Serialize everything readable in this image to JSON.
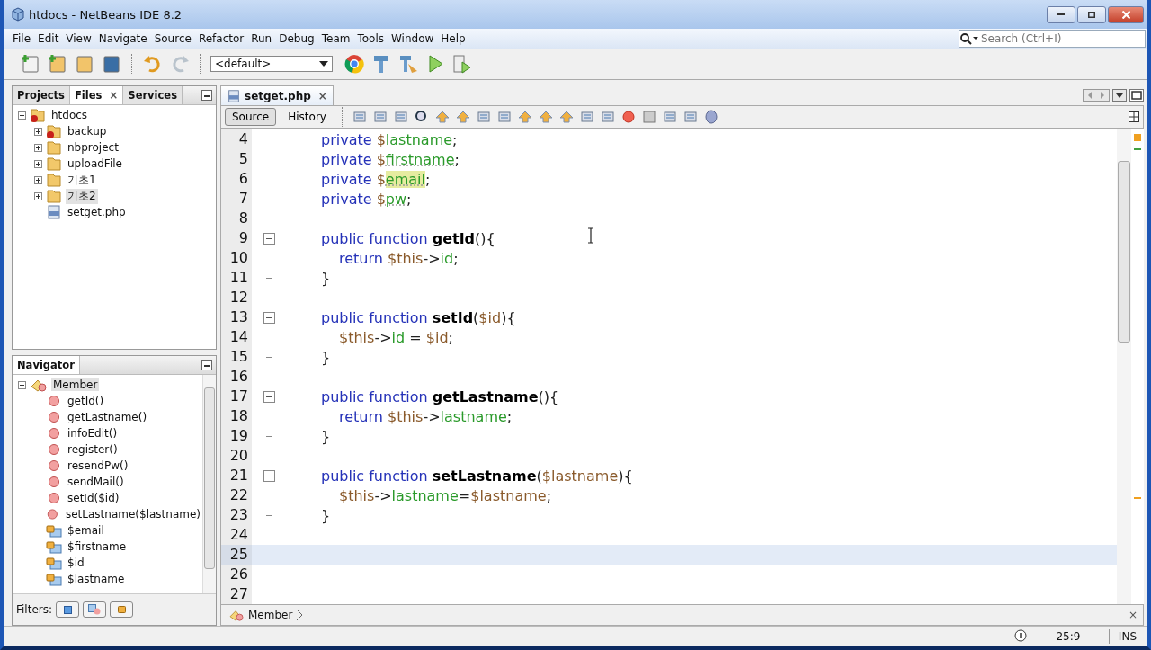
{
  "window": {
    "title": "htdocs - NetBeans IDE 8.2"
  },
  "menu": [
    "File",
    "Edit",
    "View",
    "Navigate",
    "Source",
    "Refactor",
    "Run",
    "Debug",
    "Team",
    "Tools",
    "Window",
    "Help"
  ],
  "search": {
    "placeholder": "Search (Ctrl+I)"
  },
  "config_dropdown": {
    "value": "<default>"
  },
  "side_tabs": [
    {
      "label": "Projects",
      "selected": false
    },
    {
      "label": "Files",
      "selected": true,
      "close_mark": "×"
    },
    {
      "label": "Services",
      "selected": false
    }
  ],
  "files_tree": {
    "label": "htdocs",
    "expanded": true,
    "selected": false,
    "error": true,
    "children": [
      {
        "label": "backup",
        "kind": "folder",
        "expanded": false,
        "selected": false,
        "error": true
      },
      {
        "label": "nbproject",
        "kind": "folder",
        "expanded": false,
        "selected": false,
        "error": false
      },
      {
        "label": "uploadFile",
        "kind": "folder",
        "expanded": false,
        "selected": false,
        "error": false
      },
      {
        "label": "기초1",
        "kind": "folder",
        "expanded": false,
        "selected": false,
        "error": false
      },
      {
        "label": "기초2",
        "kind": "folder",
        "expanded": false,
        "selected": true,
        "error": false
      },
      {
        "label": "setget.php",
        "kind": "file",
        "selected": false
      }
    ]
  },
  "navigator": {
    "title": "Navigator",
    "root": {
      "label": "Member",
      "selected": true,
      "children": [
        {
          "label": "getId()",
          "kind": "method"
        },
        {
          "label": "getLastname()",
          "kind": "method"
        },
        {
          "label": "infoEdit()",
          "kind": "method"
        },
        {
          "label": "register()",
          "kind": "method"
        },
        {
          "label": "resendPw()",
          "kind": "method"
        },
        {
          "label": "sendMail()",
          "kind": "method"
        },
        {
          "label": "setId($id)",
          "kind": "method"
        },
        {
          "label": "setLastname($lastname)",
          "kind": "method"
        },
        {
          "label": "$email",
          "kind": "field"
        },
        {
          "label": "$firstname",
          "kind": "field"
        },
        {
          "label": "$id",
          "kind": "field"
        },
        {
          "label": "$lastname",
          "kind": "field"
        }
      ]
    },
    "filters_label": "Filters:"
  },
  "editor_tab": {
    "label": "setget.php",
    "selected": true,
    "close_mark": "×"
  },
  "view_toggle": [
    {
      "label": "Source",
      "selected": true
    },
    {
      "label": "History",
      "selected": false
    }
  ],
  "code_lines": [
    {
      "number": "4",
      "current": false,
      "tokens": [
        {
          "t": "private ",
          "kind": "kw"
        },
        {
          "t": "$",
          "kind": "var"
        },
        {
          "t": "lastname",
          "kind": "field"
        },
        {
          "t": ";",
          "kind": "plain"
        }
      ]
    },
    {
      "number": "5",
      "current": false,
      "tokens": [
        {
          "t": "private ",
          "kind": "kw"
        },
        {
          "t": "$",
          "kind": "var"
        },
        {
          "t": "firstname",
          "kind": "field-warn"
        },
        {
          "t": ";",
          "kind": "plain"
        }
      ]
    },
    {
      "number": "6",
      "current": false,
      "tokens": [
        {
          "t": "private ",
          "kind": "kw"
        },
        {
          "t": "$",
          "kind": "var"
        },
        {
          "t": "email",
          "kind": "field-mark"
        },
        {
          "t": ";",
          "kind": "plain"
        }
      ]
    },
    {
      "number": "7",
      "current": false,
      "tokens": [
        {
          "t": "private ",
          "kind": "kw"
        },
        {
          "t": "$",
          "kind": "var"
        },
        {
          "t": "pw",
          "kind": "field-warn"
        },
        {
          "t": ";",
          "kind": "plain"
        }
      ]
    },
    {
      "number": "8",
      "current": false
    },
    {
      "number": "9",
      "current": false,
      "fold_start": true,
      "tokens": [
        {
          "t": "public function ",
          "kind": "kw"
        },
        {
          "t": "getId",
          "kind": "name"
        },
        {
          "t": "(){",
          "kind": "plain"
        }
      ],
      "children": [
        {
          "number": "10",
          "current": false,
          "tokens": [
            {
              "t": "return ",
              "kind": "kw"
            },
            {
              "t": "$this",
              "kind": "var"
            },
            {
              "t": "->",
              "kind": "plain"
            },
            {
              "t": "id",
              "kind": "field"
            },
            {
              "t": ";",
              "kind": "plain"
            }
          ]
        }
      ]
    },
    {
      "number": "11",
      "current": false,
      "fold_end": true,
      "tokens": [
        {
          "t": "}",
          "kind": "plain"
        }
      ]
    },
    {
      "number": "12",
      "current": false
    },
    {
      "number": "13",
      "current": false,
      "fold_start": true,
      "tokens": [
        {
          "t": "public function ",
          "kind": "kw"
        },
        {
          "t": "setId",
          "kind": "name"
        },
        {
          "t": "(",
          "kind": "plain"
        },
        {
          "t": "$id",
          "kind": "var"
        },
        {
          "t": "){",
          "kind": "plain"
        }
      ],
      "children": [
        {
          "number": "14",
          "current": false,
          "tokens": [
            {
              "t": "$this",
              "kind": "var"
            },
            {
              "t": "->",
              "kind": "plain"
            },
            {
              "t": "id",
              "kind": "field"
            },
            {
              "t": " = ",
              "kind": "plain"
            },
            {
              "t": "$id",
              "kind": "var"
            },
            {
              "t": ";",
              "kind": "plain"
            }
          ]
        }
      ]
    },
    {
      "number": "15",
      "current": false,
      "fold_end": true,
      "tokens": [
        {
          "t": "}",
          "kind": "plain"
        }
      ]
    },
    {
      "number": "16",
      "current": false
    },
    {
      "number": "17",
      "current": false,
      "fold_start": true,
      "tokens": [
        {
          "t": "public function ",
          "kind": "kw"
        },
        {
          "t": "getLastname",
          "kind": "name"
        },
        {
          "t": "(){",
          "kind": "plain"
        }
      ],
      "children": [
        {
          "number": "18",
          "current": false,
          "tokens": [
            {
              "t": "return ",
              "kind": "kw"
            },
            {
              "t": "$this",
              "kind": "var"
            },
            {
              "t": "->",
              "kind": "plain"
            },
            {
              "t": "lastname",
              "kind": "field"
            },
            {
              "t": ";",
              "kind": "plain"
            }
          ]
        }
      ]
    },
    {
      "number": "19",
      "current": false,
      "fold_end": true,
      "tokens": [
        {
          "t": "}",
          "kind": "plain"
        }
      ]
    },
    {
      "number": "20",
      "current": false
    },
    {
      "number": "21",
      "current": false,
      "fold_start": true,
      "tokens": [
        {
          "t": "public function ",
          "kind": "kw"
        },
        {
          "t": "setLastname",
          "kind": "name"
        },
        {
          "t": "(",
          "kind": "plain"
        },
        {
          "t": "$lastname",
          "kind": "var"
        },
        {
          "t": "){",
          "kind": "plain"
        }
      ],
      "children": [
        {
          "number": "22",
          "current": false,
          "tokens": [
            {
              "t": "$this",
              "kind": "var"
            },
            {
              "t": "->",
              "kind": "plain"
            },
            {
              "t": "lastname",
              "kind": "field"
            },
            {
              "t": "=",
              "kind": "plain"
            },
            {
              "t": "$lastname",
              "kind": "var"
            },
            {
              "t": ";",
              "kind": "plain"
            }
          ]
        }
      ]
    },
    {
      "number": "23",
      "current": false,
      "fold_end": true,
      "tokens": [
        {
          "t": "}",
          "kind": "plain"
        }
      ]
    },
    {
      "number": "24",
      "current": false
    },
    {
      "number": "25",
      "current": true
    },
    {
      "number": "26",
      "current": false
    },
    {
      "number": "27",
      "current": false
    }
  ],
  "breadcrumb": {
    "items": [
      "Member"
    ],
    "close_mark": "×"
  },
  "status_bar": {
    "position": "25:9",
    "mode": "INS"
  }
}
